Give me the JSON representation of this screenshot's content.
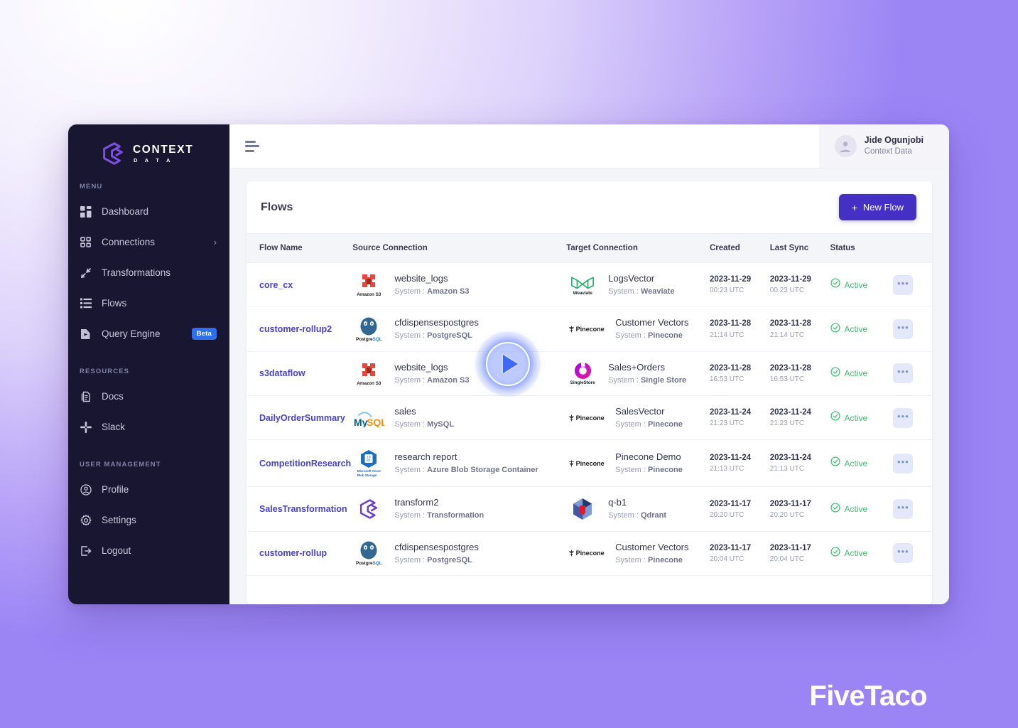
{
  "brand": {
    "title": "CONTEXT",
    "subtitle": "D A T A"
  },
  "sidebar": {
    "sections": [
      {
        "label": "MENU",
        "items": [
          {
            "label": "Dashboard",
            "icon": "dashboard-icon"
          },
          {
            "label": "Connections",
            "icon": "grid-icon",
            "chevron": "›"
          },
          {
            "label": "Transformations",
            "icon": "transform-icon"
          },
          {
            "label": "Flows",
            "icon": "list-icon"
          },
          {
            "label": "Query Engine",
            "icon": "query-icon",
            "badge": "Beta"
          }
        ]
      },
      {
        "label": "RESOURCES",
        "items": [
          {
            "label": "Docs",
            "icon": "document-icon"
          },
          {
            "label": "Slack",
            "icon": "slack-icon"
          }
        ]
      },
      {
        "label": "USER MANAGEMENT",
        "items": [
          {
            "label": "Profile",
            "icon": "user-circle-icon"
          },
          {
            "label": "Settings",
            "icon": "gear-icon"
          },
          {
            "label": "Logout",
            "icon": "logout-icon"
          }
        ]
      }
    ]
  },
  "topbar": {
    "menu_toggle": "hamburger-icon",
    "user": {
      "name": "Jide Ogunjobi",
      "org": "Context Data"
    }
  },
  "card": {
    "title": "Flows",
    "new_flow_label": "New Flow",
    "new_flow_plus": "+"
  },
  "table": {
    "columns": [
      "Flow Name",
      "Source Connection",
      "Target Connection",
      "Created",
      "Last Sync",
      "Status",
      ""
    ],
    "row_action_label": "•••",
    "rows": [
      {
        "name": "core_cx",
        "source": {
          "logo": "amazon-s3-logo",
          "caption": "Amazon S3",
          "title": "website_logs",
          "system_prefix": "System :",
          "system": "Amazon S3"
        },
        "target": {
          "logo": "weaviate-logo",
          "caption": "Weaviate",
          "title": "LogsVector",
          "system_prefix": "System :",
          "system": "Weaviate"
        },
        "created": {
          "date": "2023-11-29",
          "time": "00:23 UTC"
        },
        "last_sync": {
          "date": "2023-11-29",
          "time": "00:23 UTC"
        },
        "status": "Active"
      },
      {
        "name": "customer-rollup2",
        "source": {
          "logo": "postgresql-logo",
          "caption": "PostgreSQL",
          "title": "cfdispensespostgres",
          "system_prefix": "System :",
          "system": "PostgreSQL"
        },
        "target": {
          "logo": "pinecone-logo",
          "caption": "Pinecone",
          "title": "Customer Vectors",
          "system_prefix": "System :",
          "system": "Pinecone"
        },
        "created": {
          "date": "2023-11-28",
          "time": "21:14 UTC"
        },
        "last_sync": {
          "date": "2023-11-28",
          "time": "21:14 UTC"
        },
        "status": "Active"
      },
      {
        "name": "s3dataflow",
        "source": {
          "logo": "amazon-s3-logo",
          "caption": "Amazon S3",
          "title": "website_logs",
          "system_prefix": "System :",
          "system": "Amazon S3"
        },
        "target": {
          "logo": "singlestore-logo",
          "caption": "SingleStore",
          "title": "Sales+Orders",
          "system_prefix": "System :",
          "system": "Single Store"
        },
        "created": {
          "date": "2023-11-28",
          "time": "16:53 UTC"
        },
        "last_sync": {
          "date": "2023-11-28",
          "time": "16:53 UTC"
        },
        "status": "Active"
      },
      {
        "name": "DailyOrderSummary",
        "source": {
          "logo": "mysql-logo",
          "caption": "MySQL",
          "title": "sales",
          "system_prefix": "System :",
          "system": "MySQL"
        },
        "target": {
          "logo": "pinecone-logo",
          "caption": "Pinecone",
          "title": "SalesVector",
          "system_prefix": "System :",
          "system": "Pinecone"
        },
        "created": {
          "date": "2023-11-24",
          "time": "21:23 UTC"
        },
        "last_sync": {
          "date": "2023-11-24",
          "time": "21:23 UTC"
        },
        "status": "Active"
      },
      {
        "name": "CompetitionResearch",
        "source": {
          "logo": "azure-blob-storage-logo",
          "caption": "Microsoft Azure Blob Storage",
          "title": "research report",
          "system_prefix": "System :",
          "system": "Azure Blob Storage Container"
        },
        "target": {
          "logo": "pinecone-logo",
          "caption": "Pinecone",
          "title": "Pinecone Demo",
          "system_prefix": "System :",
          "system": "Pinecone"
        },
        "created": {
          "date": "2023-11-24",
          "time": "21:13 UTC"
        },
        "last_sync": {
          "date": "2023-11-24",
          "time": "21:13 UTC"
        },
        "status": "Active"
      },
      {
        "name": "SalesTransformation",
        "source": {
          "logo": "context-data-logo",
          "caption": "",
          "title": "transform2",
          "system_prefix": "System :",
          "system": "Transformation"
        },
        "target": {
          "logo": "qdrant-logo",
          "caption": "",
          "title": "q-b1",
          "system_prefix": "System :",
          "system": "Qdrant"
        },
        "created": {
          "date": "2023-11-17",
          "time": "20:20 UTC"
        },
        "last_sync": {
          "date": "2023-11-17",
          "time": "20:20 UTC"
        },
        "status": "Active"
      },
      {
        "name": "customer-rollup",
        "source": {
          "logo": "postgresql-logo",
          "caption": "PostgreSQL",
          "title": "cfdispensespostgres",
          "system_prefix": "System :",
          "system": "PostgreSQL"
        },
        "target": {
          "logo": "pinecone-logo",
          "caption": "Pinecone",
          "title": "Customer Vectors",
          "system_prefix": "System :",
          "system": "Pinecone"
        },
        "created": {
          "date": "2023-11-17",
          "time": "20:04 UTC"
        },
        "last_sync": {
          "date": "2023-11-17",
          "time": "20:04 UTC"
        },
        "status": "Active"
      }
    ]
  },
  "overlay": {
    "play_button": "play-icon"
  },
  "watermark": {
    "text": "FiveTaco"
  },
  "colors": {
    "accent": "#4430c4",
    "sidebar_bg": "#181630",
    "flow_link": "#4a41c9",
    "status_active": "#39c06c",
    "beta_badge": "#2f6fed",
    "page_bg_start": "#f7f4ff",
    "page_bg_end": "#8b73f2"
  }
}
